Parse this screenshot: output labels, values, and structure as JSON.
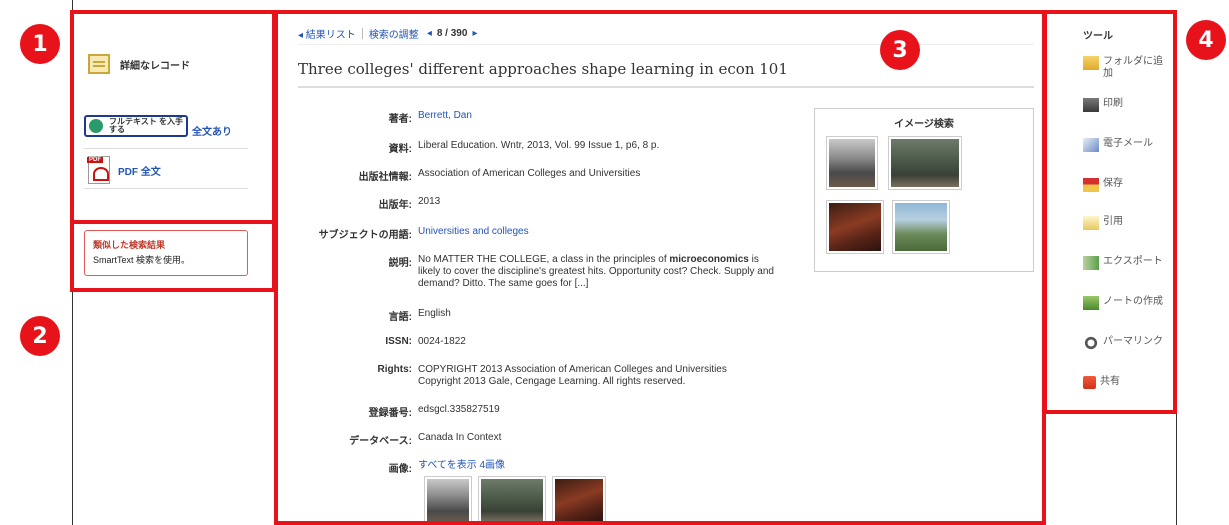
{
  "callouts": [
    "1",
    "2",
    "3",
    "4"
  ],
  "left": {
    "detailed_record": "詳細なレコード",
    "fulltext_button": "フルテキスト を入手する",
    "fulltext_available": "全文あり",
    "pdf_fulltext": "PDF 全文",
    "similar_title": "類似した検索結果",
    "similar_sub": "SmartText 検索を使用。"
  },
  "nav": {
    "results_list": "◂ 結果リスト",
    "refine_search": "検索の調整",
    "prev_arrow": "◂",
    "position": "8 / 390",
    "next_arrow": "▸"
  },
  "article": {
    "title": "Three colleges' different approaches shape learning in econ 101",
    "fields": [
      {
        "label": "著者:",
        "value": "Berrett, Dan",
        "link": true
      },
      {
        "label": "資料:",
        "value": "Liberal Education. Wntr, 2013, Vol. 99 Issue 1, p6, 8 p.",
        "link": false
      },
      {
        "label": "出版社情報:",
        "value": "Association of American Colleges and Universities",
        "link": false
      },
      {
        "label": "出版年:",
        "value": "2013",
        "link": false
      },
      {
        "label": "サブジェクトの用語:",
        "value": "Universities and colleges",
        "link": true
      },
      {
        "label": "説明:",
        "value_pre": "No MATTER THE COLLEGE, a class in the principles of ",
        "value_bold": "microeconomics",
        "value_post": " is likely to cover the discipline's greatest hits. Opportunity cost? Check. Supply and demand? Ditto. The same goes for [...]",
        "link": false
      },
      {
        "label": "言語:",
        "value": "English",
        "link": false
      },
      {
        "label": "ISSN:",
        "value": "0024-1822",
        "link": false
      },
      {
        "label": "Rights:",
        "value": "COPYRIGHT 2013 Association of American Colleges and Universities Copyright 2013 Gale, Cengage Learning. All rights reserved.",
        "link": false
      },
      {
        "label": "登録番号:",
        "value": "edsgcl.335827519",
        "link": false
      },
      {
        "label": "データベース:",
        "value": "Canada In Context",
        "link": false
      },
      {
        "label": "画像:",
        "value": "すべてを表示 4画像",
        "link": true
      }
    ]
  },
  "image_search": {
    "title": "イメージ検索"
  },
  "tools": {
    "heading": "ツール",
    "items": [
      {
        "label": "フォルダに追加",
        "icon": "folder-icon"
      },
      {
        "label": "印刷",
        "icon": "printer-icon"
      },
      {
        "label": "電子メール",
        "icon": "email-icon"
      },
      {
        "label": "保存",
        "icon": "save-icon"
      },
      {
        "label": "引用",
        "icon": "cite-icon"
      },
      {
        "label": "エクスポート",
        "icon": "export-icon"
      },
      {
        "label": "ノートの作成",
        "icon": "note-icon"
      },
      {
        "label": "パーマリンク",
        "icon": "permalink-icon"
      },
      {
        "label": "共有",
        "icon": "share-icon"
      }
    ]
  },
  "colors": {
    "highlight": "#e8121a",
    "link": "#2254b8"
  }
}
